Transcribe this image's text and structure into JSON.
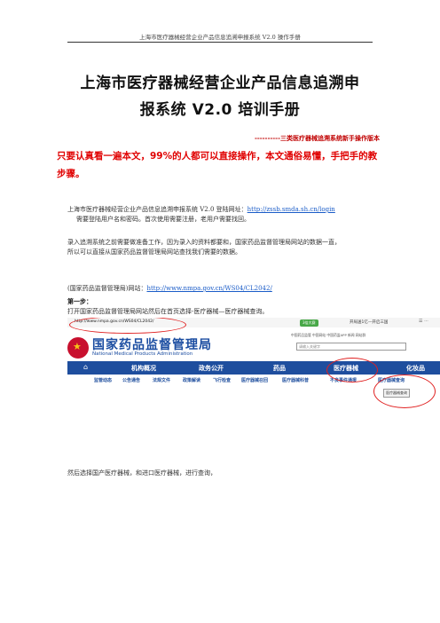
{
  "header": {
    "running_title": "上海市医疗器械经营企业产品信息追溯申报系统 V2.0 操作手册"
  },
  "title": {
    "line1": "上海市医疗器械经营企业产品信息追溯申",
    "line2": "报系统 V2.0 培训手册"
  },
  "subtitle": "----------三类医疗器械追溯系统新手操作版本",
  "intro": "只要认真看一遍本文，99%的人都可以直接操作，本文通俗易懂，手把手的教步骤。",
  "paragraphs": {
    "login_prefix": "上海市医疗器械经营企业产品信息追溯申报系统 V2.0 登陆网址：",
    "login_url": "http://zssb.smda.sh.cn/login",
    "login_note": "需要登陆用户名和密码。首次使用需要注册，老用户需要找回。",
    "prep_line1": "录入追溯系统之前需要做准备工作，因为录入的资料都要和，国家药品监督管理局网站的数据一直，",
    "prep_line2": "所以可以直接从国家药品监督管理局网站查找我们需要的数据。",
    "site_prefix": "(国家药品监督管理局)网站：",
    "site_url": "http://www.nmpa.gov.cn/WS04/CL2042/",
    "step1_label": "第一步：",
    "step1_text": "打开国家药品监督管理局网站然后在首页选择-医疗器械—医疗器械查询。",
    "after_text": "然后选择国产医疗器械，和进口医疗器械，进行查询，"
  },
  "screenshot": {
    "url": "http://www.nmpa.gov.cn/WS04/CL2042/",
    "badge": "3倍大赛",
    "search_tip": "开局送1亿—开启三国",
    "site_name": "国家药品监督管理局",
    "site_en": "National Medical Products Administration",
    "top_links": "中国药品监管   中国网站   中国药监APP   新闻   网站群",
    "search_placeholder": "请输入关键字",
    "nav": [
      "机构概况",
      "政务公开",
      "药品",
      "医疗器械",
      "化妆品"
    ],
    "subnav": [
      "监管动态",
      "公告通告",
      "法规文件",
      "政策解读",
      "飞行检查",
      "医疗器械召回",
      "医疗器械科普",
      "不良事件通报",
      "医疗器械查询"
    ],
    "tip": "医疗器械查询"
  }
}
